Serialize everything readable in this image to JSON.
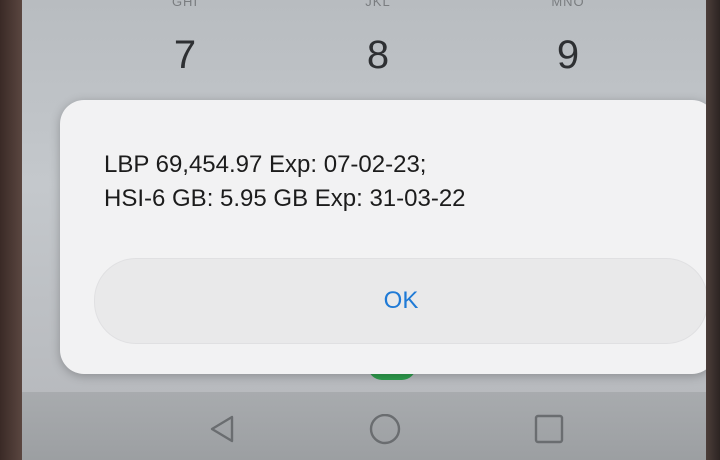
{
  "dialpad": {
    "keys": [
      {
        "letters": "GHI",
        "digit": "7"
      },
      {
        "letters": "JKL",
        "digit": "8"
      },
      {
        "letters": "MNO",
        "digit": "9"
      }
    ]
  },
  "dialog": {
    "lines": [
      "LBP 69,454.97 Exp: 07-02-23;",
      "HSI-6 GB: 5.95 GB Exp: 31-03-22"
    ],
    "ok_label": "OK"
  },
  "navbar": {
    "icons": [
      "back-icon",
      "home-icon",
      "recent-apps-icon"
    ]
  },
  "colors": {
    "accent": "#1f7ad6",
    "call_button": "#2f9e4e"
  }
}
